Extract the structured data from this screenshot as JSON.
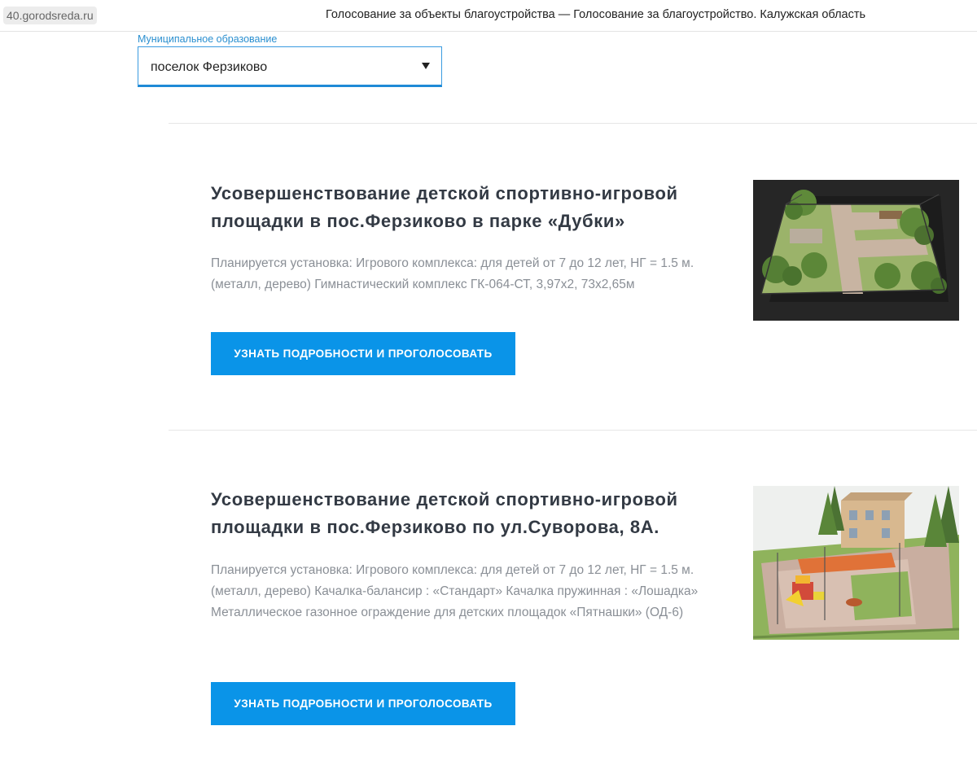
{
  "topbar": {
    "domain": "40.gorodsreda.ru",
    "title": "Голосование за объекты благоустройства — Голосование за благоустройство. Калужская область"
  },
  "filter": {
    "label": "Муниципальное образование",
    "selected": "поселок Ферзиково"
  },
  "projects": [
    {
      "title": "Усовершенствование детской спортивно-игровой площадки в пос.Ферзиково в парке «Дубки»",
      "description": "Планируется установка: Игрового комплекса: для детей от 7 до 12 лет, НГ = 1.5 м. (металл, дерево) Гимнастический комплекс ГК-064-СТ, 3,97х2, 73х2,65м",
      "button": "Узнать подробности и проголосовать"
    },
    {
      "title": "Усовершенствование детской спортивно-игровой площадки в пос.Ферзиково по ул.Суворова, 8А.",
      "description": "Планируется установка: Игрового комплекса: для детей от 7 до 12 лет, НГ = 1.5 м. (металл, дерево) Качалка-балансир : «Стандарт» Качалка пружинная : «Лошадка» Металлическое газонное ограждение для детских площадок «Пятнашки» (ОД-6)",
      "button": "Узнать подробности и проголосовать"
    }
  ],
  "colors": {
    "accent": "#0a94e8",
    "title": "#333a44",
    "description": "#8a8f96",
    "label": "#2a8fd0"
  }
}
